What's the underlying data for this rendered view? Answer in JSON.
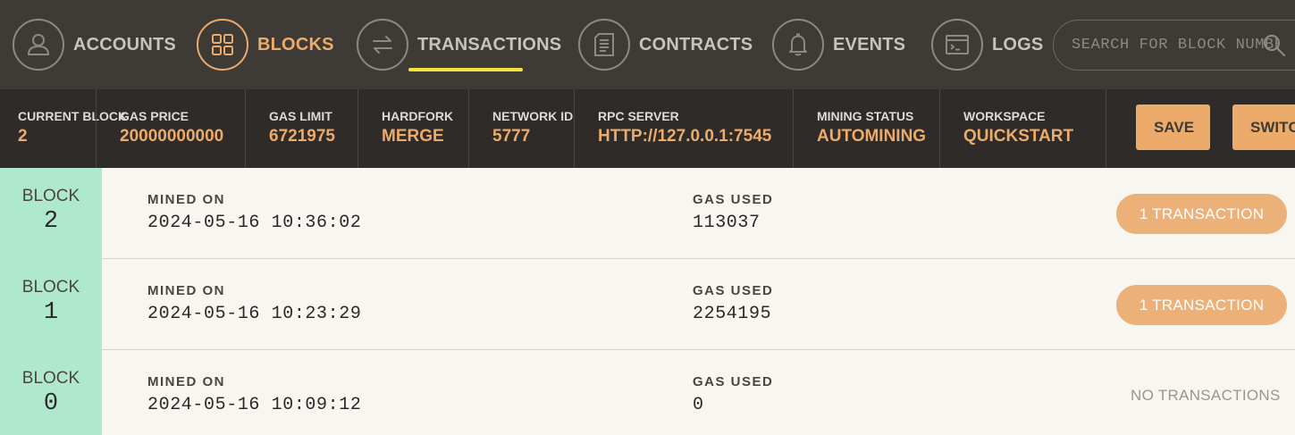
{
  "nav": {
    "items": [
      {
        "label": "ACCOUNTS",
        "icon": "user-icon"
      },
      {
        "label": "BLOCKS",
        "icon": "grid-icon"
      },
      {
        "label": "TRANSACTIONS",
        "icon": "swap-arrows-icon"
      },
      {
        "label": "CONTRACTS",
        "icon": "document-icon"
      },
      {
        "label": "EVENTS",
        "icon": "bell-icon"
      },
      {
        "label": "LOGS",
        "icon": "terminal-icon"
      }
    ],
    "active": "BLOCKS",
    "underlined": "TRANSACTIONS"
  },
  "search": {
    "placeholder": "SEARCH FOR BLOCK NUMBERS OR TX HASHES",
    "icon": "search-icon"
  },
  "status": {
    "current_block": {
      "label": "CURRENT BLOCK",
      "value": "2"
    },
    "gas_price": {
      "label": "GAS PRICE",
      "value": "20000000000"
    },
    "gas_limit": {
      "label": "GAS LIMIT",
      "value": "6721975"
    },
    "hardfork": {
      "label": "HARDFORK",
      "value": "MERGE"
    },
    "network_id": {
      "label": "NETWORK ID",
      "value": "5777"
    },
    "rpc_server": {
      "label": "RPC SERVER",
      "value": "HTTP://127.0.0.1:7545"
    },
    "mining_status": {
      "label": "MINING STATUS",
      "value": "AUTOMINING"
    },
    "workspace": {
      "label": "WORKSPACE",
      "value": "QUICKSTART"
    }
  },
  "buttons": {
    "save": "SAVE",
    "switch": "SWITCH"
  },
  "blocks": [
    {
      "label": "BLOCK",
      "number": "2",
      "mined_label": "MINED ON",
      "mined_on": "2024-05-16 10:36:02",
      "gas_label": "GAS USED",
      "gas_used": "113037",
      "tx": "1 TRANSACTION"
    },
    {
      "label": "BLOCK",
      "number": "1",
      "mined_label": "MINED ON",
      "mined_on": "2024-05-16 10:23:29",
      "gas_label": "GAS USED",
      "gas_used": "2254195",
      "tx": "1 TRANSACTION"
    },
    {
      "label": "BLOCK",
      "number": "0",
      "mined_label": "MINED ON",
      "mined_on": "2024-05-16 10:09:12",
      "gas_label": "GAS USED",
      "gas_used": "0",
      "tx": "NO TRANSACTIONS"
    }
  ],
  "colors": {
    "nav_bg": "#3e3a36",
    "status_bg": "#2f2b28",
    "accent": "#ecab6b",
    "block_badge": "#aee9cf",
    "underline": "#f2e43c"
  }
}
